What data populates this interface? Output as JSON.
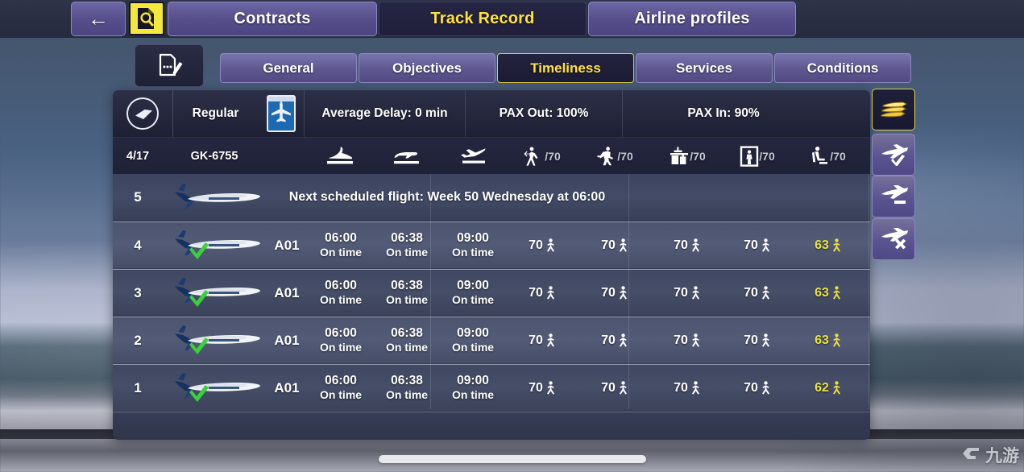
{
  "topnav": {
    "back_label": "←",
    "search_icon": "document-search-icon",
    "items": [
      {
        "label": "Contracts",
        "active": false
      },
      {
        "label": "Track Record",
        "active": true
      },
      {
        "label": "Airline profiles",
        "active": false
      }
    ]
  },
  "tabs": {
    "edit_icon": "document-edit-icon",
    "items": [
      {
        "label": "General",
        "active": false
      },
      {
        "label": "Objectives",
        "active": false
      },
      {
        "label": "Timeliness",
        "active": true
      },
      {
        "label": "Services",
        "active": false
      },
      {
        "label": "Conditions",
        "active": false
      }
    ]
  },
  "summary": {
    "airline_logo_icon": "airline-logo-icon",
    "contract_class": "Regular",
    "aircraft_badge_icon": "aircraft-badge-icon",
    "average_delay": "Average Delay: 0 min",
    "pax_out": "PAX Out: 100%",
    "pax_in": "PAX In: 90%"
  },
  "header": {
    "progress": "4/17",
    "flight_code": "GK-6755",
    "columns": [
      {
        "icon": "plane-landing-icon",
        "suffix": ""
      },
      {
        "icon": "plane-parked-icon",
        "suffix": ""
      },
      {
        "icon": "plane-takeoff-icon",
        "suffix": ""
      },
      {
        "icon": "checkin-icon",
        "suffix": "/70"
      },
      {
        "icon": "security-check-icon",
        "suffix": "/70"
      },
      {
        "icon": "baggage-drop-icon",
        "suffix": "/70"
      },
      {
        "icon": "body-scanner-icon",
        "suffix": "/70"
      },
      {
        "icon": "boarding-seat-icon",
        "suffix": "/70"
      }
    ]
  },
  "schedule": {
    "index": "5",
    "aircraft_livery": "Glenn Airlines",
    "text": "Next scheduled flight: Week 50 Wednesday at 06:00"
  },
  "colors": {
    "accent_yellow": "#ffe23c",
    "warn_yellow": "#e9e03c",
    "panel_dark": "#1f2136",
    "button_purple": "#5a5490"
  },
  "rows": [
    {
      "index": "4",
      "aircraft_livery": "Glenn Airlines",
      "status_icon": "green-check-icon",
      "gate": "A01",
      "times": [
        {
          "time": "06:00",
          "status": "On time"
        },
        {
          "time": "06:38",
          "status": "On time"
        },
        {
          "time": "09:00",
          "status": "On time"
        }
      ],
      "pax": [
        {
          "value": "70",
          "warn": false
        },
        {
          "value": "70",
          "warn": false
        },
        {
          "value": "70",
          "warn": false
        },
        {
          "value": "70",
          "warn": false
        },
        {
          "value": "63",
          "warn": true
        }
      ]
    },
    {
      "index": "3",
      "aircraft_livery": "Glenn Airlines",
      "status_icon": "green-check-icon",
      "gate": "A01",
      "times": [
        {
          "time": "06:00",
          "status": "On time"
        },
        {
          "time": "06:38",
          "status": "On time"
        },
        {
          "time": "09:00",
          "status": "On time"
        }
      ],
      "pax": [
        {
          "value": "70",
          "warn": false
        },
        {
          "value": "70",
          "warn": false
        },
        {
          "value": "70",
          "warn": false
        },
        {
          "value": "70",
          "warn": false
        },
        {
          "value": "63",
          "warn": true
        }
      ]
    },
    {
      "index": "2",
      "aircraft_livery": "Glenn Airlines",
      "status_icon": "green-check-icon",
      "gate": "A01",
      "times": [
        {
          "time": "06:00",
          "status": "On time"
        },
        {
          "time": "06:38",
          "status": "On time"
        },
        {
          "time": "09:00",
          "status": "On time"
        }
      ],
      "pax": [
        {
          "value": "70",
          "warn": false
        },
        {
          "value": "70",
          "warn": false
        },
        {
          "value": "70",
          "warn": false
        },
        {
          "value": "70",
          "warn": false
        },
        {
          "value": "63",
          "warn": true
        }
      ]
    },
    {
      "index": "1",
      "aircraft_livery": "Glenn Airlines",
      "status_icon": "green-check-icon",
      "gate": "A01",
      "times": [
        {
          "time": "06:00",
          "status": "On time"
        },
        {
          "time": "06:38",
          "status": "On time"
        },
        {
          "time": "09:00",
          "status": "On time"
        }
      ],
      "pax": [
        {
          "value": "70",
          "warn": false
        },
        {
          "value": "70",
          "warn": false
        },
        {
          "value": "70",
          "warn": false
        },
        {
          "value": "70",
          "warn": false
        },
        {
          "value": "62",
          "warn": true
        }
      ]
    }
  ],
  "filters": [
    {
      "icon": "stacked-gold-flights-icon",
      "active": true
    },
    {
      "icon": "plane-check-icon",
      "active": false
    },
    {
      "icon": "plane-minus-icon",
      "active": false
    },
    {
      "icon": "plane-cross-icon",
      "active": false
    }
  ],
  "watermark": {
    "text": "九游",
    "logo_icon": "g-logo-icon"
  }
}
